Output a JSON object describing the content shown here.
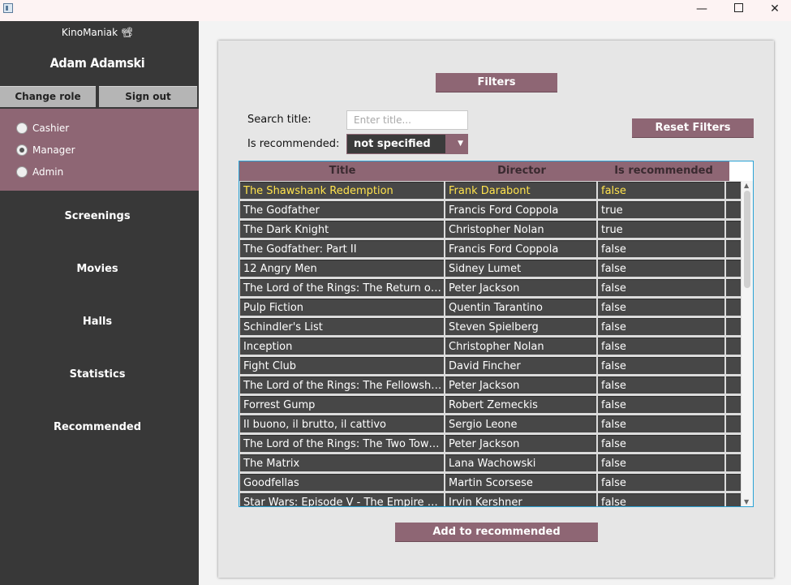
{
  "window": {
    "minimize_icon": "minimize-icon",
    "maximize_icon": "maximize-icon",
    "close_icon": "close-icon",
    "close_glyph": "✕",
    "minimize_glyph": "—"
  },
  "sidebar": {
    "app_name": "KinoManiak 📽",
    "user_name": "Adam Adamski",
    "change_role_label": "Change role",
    "sign_out_label": "Sign out",
    "roles": [
      {
        "label": "Cashier",
        "checked": false
      },
      {
        "label": "Manager",
        "checked": true
      },
      {
        "label": "Admin",
        "checked": false
      }
    ],
    "nav": [
      "Screenings",
      "Movies",
      "Halls",
      "Statistics",
      "Recommended"
    ]
  },
  "filters": {
    "header_label": "Filters",
    "search_label": "Search title:",
    "search_placeholder": "Enter title...",
    "search_value": "",
    "recommended_label": "Is recommended:",
    "recommended_value": "not specified",
    "reset_label": "Reset Filters"
  },
  "table": {
    "columns": [
      "Title",
      "Director",
      "Is recommended"
    ],
    "selected_row": 0,
    "rows": [
      [
        "The Shawshank Redemption",
        "Frank Darabont",
        "false"
      ],
      [
        "The Godfather",
        "Francis Ford Coppola",
        "true"
      ],
      [
        "The Dark Knight",
        "Christopher Nolan",
        "true"
      ],
      [
        "The Godfather: Part II",
        "Francis Ford Coppola",
        "false"
      ],
      [
        "12 Angry Men",
        "Sidney Lumet",
        "false"
      ],
      [
        "The Lord of the Rings: The Return of the King",
        "Peter Jackson",
        "false"
      ],
      [
        "Pulp Fiction",
        "Quentin Tarantino",
        "false"
      ],
      [
        "Schindler's List",
        "Steven Spielberg",
        "false"
      ],
      [
        "Inception",
        "Christopher Nolan",
        "false"
      ],
      [
        "Fight Club",
        "David Fincher",
        "false"
      ],
      [
        "The Lord of the Rings: The Fellowship of the Ring",
        "Peter Jackson",
        "false"
      ],
      [
        "Forrest Gump",
        "Robert Zemeckis",
        "false"
      ],
      [
        "Il buono, il brutto, il cattivo",
        "Sergio Leone",
        "false"
      ],
      [
        "The Lord of the Rings: The Two Towers",
        "Peter Jackson",
        "false"
      ],
      [
        "The Matrix",
        "Lana Wachowski",
        "false"
      ],
      [
        "Goodfellas",
        "Martin Scorsese",
        "false"
      ],
      [
        "Star Wars: Episode V - The Empire Strikes Back",
        "Irvin Kershner",
        "false"
      ]
    ]
  },
  "actions": {
    "add_recommended_label": "Add to recommended"
  }
}
